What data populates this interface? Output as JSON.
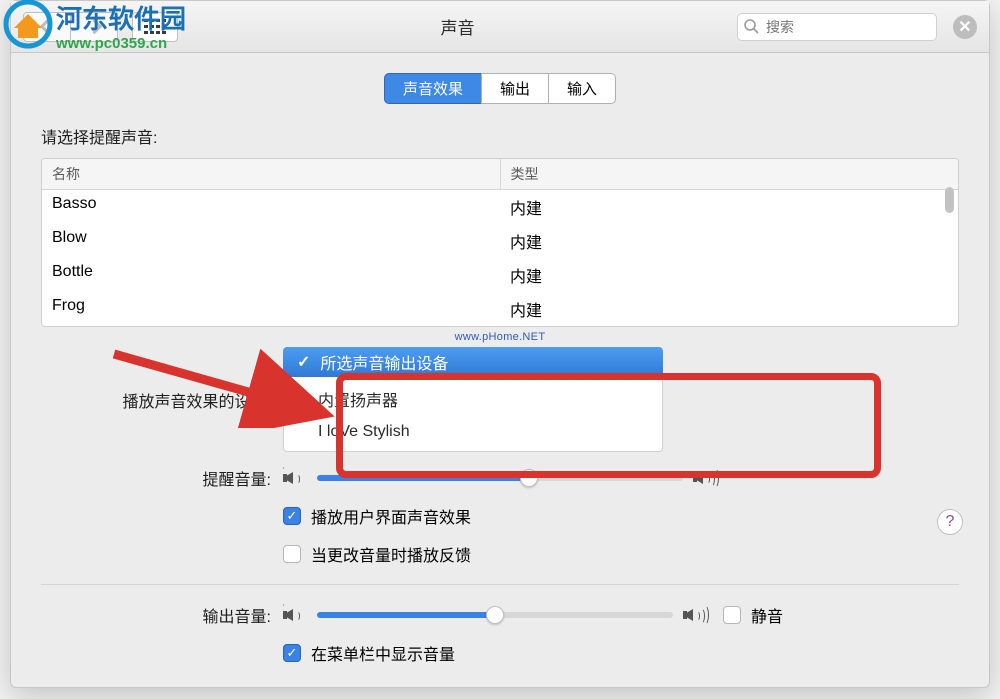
{
  "header": {
    "title": "声音",
    "search_placeholder": "搜索"
  },
  "watermark": {
    "top_site": "河东软件园",
    "top_url": "www.pc0359.cn",
    "mid": "www.pHome.NET"
  },
  "tabs": [
    {
      "label": "声音效果",
      "active": true
    },
    {
      "label": "输出",
      "active": false
    },
    {
      "label": "输入",
      "active": false
    }
  ],
  "alert_section": {
    "label": "请选择提醒声音:",
    "columns": {
      "name": "名称",
      "type": "类型"
    },
    "rows": [
      {
        "name": "Basso",
        "type": "内建"
      },
      {
        "name": "Blow",
        "type": "内建"
      },
      {
        "name": "Bottle",
        "type": "内建"
      },
      {
        "name": "Frog",
        "type": "内建"
      }
    ]
  },
  "device_row": {
    "label": "播放声音效果的设备:",
    "selected": "所选声音输出设备",
    "options": [
      "内置扬声器",
      "I loVe Stylish"
    ]
  },
  "alert_volume": {
    "label": "提醒音量:",
    "value_pct": 58
  },
  "checkboxes": {
    "ui_sound": {
      "label": "播放用户界面声音效果",
      "checked": true
    },
    "feedback": {
      "label": "当更改音量时播放反馈",
      "checked": false
    },
    "menubar": {
      "label": "在菜单栏中显示音量",
      "checked": true
    }
  },
  "output_volume": {
    "label": "输出音量:",
    "value_pct": 50,
    "mute_label": "静音",
    "mute_checked": false
  },
  "help": "?"
}
